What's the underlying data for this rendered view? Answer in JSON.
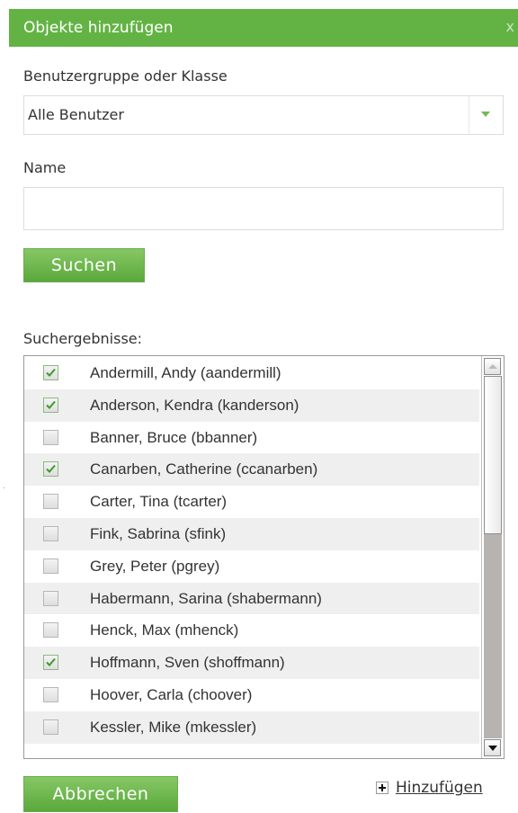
{
  "dialog": {
    "title": "Objekte hinzufügen",
    "close_label": "x"
  },
  "group_field": {
    "label": "Benutzergruppe oder Klasse",
    "selected": "Alle Benutzer"
  },
  "name_field": {
    "label": "Name",
    "value": "",
    "placeholder": ""
  },
  "search_button": "Suchen",
  "results": {
    "label": "Suchergebnisse:",
    "items": [
      {
        "name": "Andermill, Andy (aandermill)",
        "checked": true
      },
      {
        "name": "Anderson, Kendra (kanderson)",
        "checked": true
      },
      {
        "name": "Banner, Bruce (bbanner)",
        "checked": false
      },
      {
        "name": "Canarben, Catherine (ccanarben)",
        "checked": true
      },
      {
        "name": "Carter, Tina (tcarter)",
        "checked": false
      },
      {
        "name": "Fink, Sabrina (sfink)",
        "checked": false
      },
      {
        "name": "Grey, Peter (pgrey)",
        "checked": false
      },
      {
        "name": "Habermann, Sarina (shabermann)",
        "checked": false
      },
      {
        "name": "Henck, Max (mhenck)",
        "checked": false
      },
      {
        "name": "Hoffmann, Sven (shoffmann)",
        "checked": true
      },
      {
        "name": "Hoover, Carla (choover)",
        "checked": false
      },
      {
        "name": "Kessler, Mike (mkessler)",
        "checked": false
      }
    ]
  },
  "cancel_button": "Abbrechen",
  "add_link": "Hinzufügen",
  "colors": {
    "accent": "#63b344",
    "check": "#3d9a2a",
    "row_alt": "#efefef"
  }
}
